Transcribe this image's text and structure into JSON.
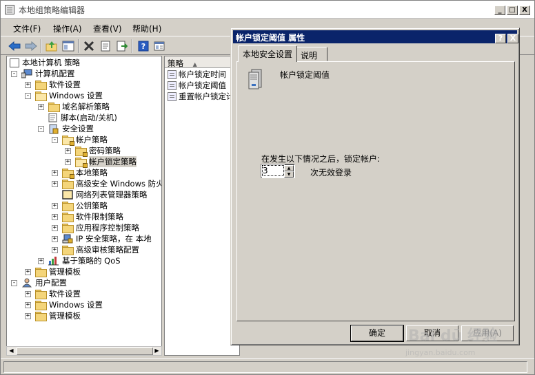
{
  "window": {
    "title": "本地组策略编辑器",
    "min": "_",
    "max": "□",
    "close": "X"
  },
  "menu": [
    "文件(F)",
    "操作(A)",
    "查看(V)",
    "帮助(H)"
  ],
  "tree": [
    {
      "label": "本地计算机 策略",
      "exp": ""
    },
    {
      "label": "计算机配置",
      "exp": "-"
    },
    {
      "label": "软件设置",
      "exp": "+"
    },
    {
      "label": "Windows 设置",
      "exp": "-"
    },
    {
      "label": "域名解析策略",
      "exp": "+"
    },
    {
      "label": "脚本(启动/关机)",
      "exp": ""
    },
    {
      "label": "安全设置",
      "exp": "-"
    },
    {
      "label": "帐户策略",
      "exp": "-"
    },
    {
      "label": "密码策略",
      "exp": "+"
    },
    {
      "label": "帐户锁定策略",
      "exp": "+"
    },
    {
      "label": "本地策略",
      "exp": "+"
    },
    {
      "label": "高级安全 Windows 防火",
      "exp": "+"
    },
    {
      "label": "网络列表管理器策略",
      "exp": ""
    },
    {
      "label": "公钥策略",
      "exp": "+"
    },
    {
      "label": "软件限制策略",
      "exp": "+"
    },
    {
      "label": "应用程序控制策略",
      "exp": "+"
    },
    {
      "label": "IP 安全策略，在 本地",
      "exp": "+"
    },
    {
      "label": "高级审核策略配置",
      "exp": "+"
    },
    {
      "label": "基于策略的 QoS",
      "exp": "+"
    },
    {
      "label": "管理模板",
      "exp": "+"
    },
    {
      "label": "用户配置",
      "exp": "-"
    },
    {
      "label": "软件设置",
      "exp": "+"
    },
    {
      "label": "Windows 设置",
      "exp": "+"
    },
    {
      "label": "管理模板",
      "exp": "+"
    }
  ],
  "list": {
    "header": "策略",
    "rows": [
      "帐户锁定时间",
      "帐户锁定阈值",
      "重置帐户锁定计"
    ]
  },
  "dialog": {
    "title": "帐户锁定阈值 属性",
    "help": "?",
    "close": "X",
    "tabs": [
      "本地安全设置",
      "说明"
    ],
    "policy_name": "帐户锁定阈值",
    "prompt": "在发生以下情况之后，锁定帐户:",
    "threshold_value": "3",
    "suffix": "次无效登录",
    "ok": "确定",
    "cancel": "取消",
    "apply": "应用(A)"
  },
  "watermark": {
    "main": "Bai dū 经验",
    "sub": "jingyan.baidu.com"
  }
}
